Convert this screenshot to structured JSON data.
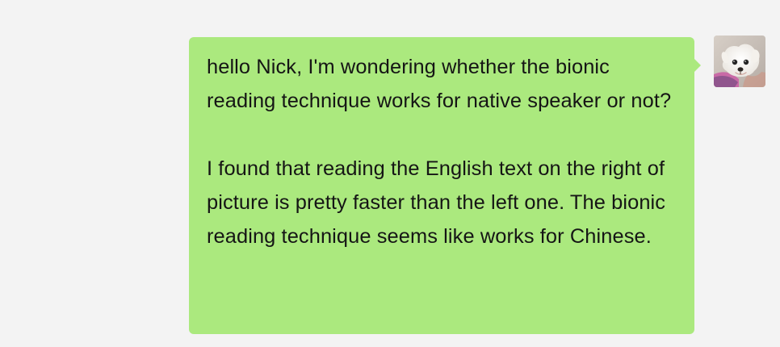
{
  "conversation": {
    "top_cutoff_text": "",
    "message": {
      "paragraph_1": "hello Nick, I'm wondering whether the bionic reading technique works for native speaker or not?",
      "paragraph_2": "I found that reading the English text on the right of picture is pretty faster than the left one. The bionic reading technique seems like works for Chinese."
    },
    "avatar": {
      "icon": "dog-photo-avatar"
    }
  },
  "colors": {
    "background": "#f3f3f3",
    "outgoing_bubble": "#abe97e",
    "text": "#151515"
  }
}
